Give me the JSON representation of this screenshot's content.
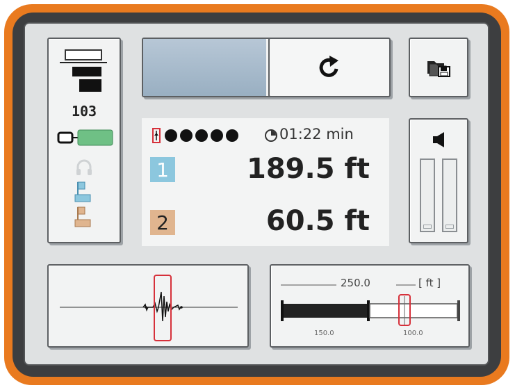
{
  "status": {
    "gain_value": "103",
    "battery_level": 1.0,
    "icons": [
      "signal-bars-icon",
      "battery-icon",
      "headphones-icon",
      "marker-1-flag-icon",
      "marker-2-flag-icon"
    ]
  },
  "progress": {
    "fill_fraction": 0.5,
    "refresh_icon": "refresh-icon"
  },
  "folder": {
    "icon": "folder-save-icon"
  },
  "readout": {
    "signal_quality_dots": 5,
    "timer": "01:22 min",
    "marker1": {
      "label": "1",
      "distance": "189.5 ft",
      "color": "#8cc7de"
    },
    "marker2": {
      "label": "2",
      "distance": "60.5 ft",
      "color": "#e0b58f"
    }
  },
  "volume": {
    "icon": "speaker-icon",
    "left_level": 0,
    "right_level": 0
  },
  "range": {
    "total": "250.0",
    "unit": "[ ft ]",
    "tick_left": "150.0",
    "tick_right": "100.0"
  },
  "colors": {
    "frame": "#e97a1f",
    "accent_red": "#d6303a",
    "marker1": "#8cc7de",
    "marker2": "#e0b58f",
    "battery": "#6fc085"
  }
}
